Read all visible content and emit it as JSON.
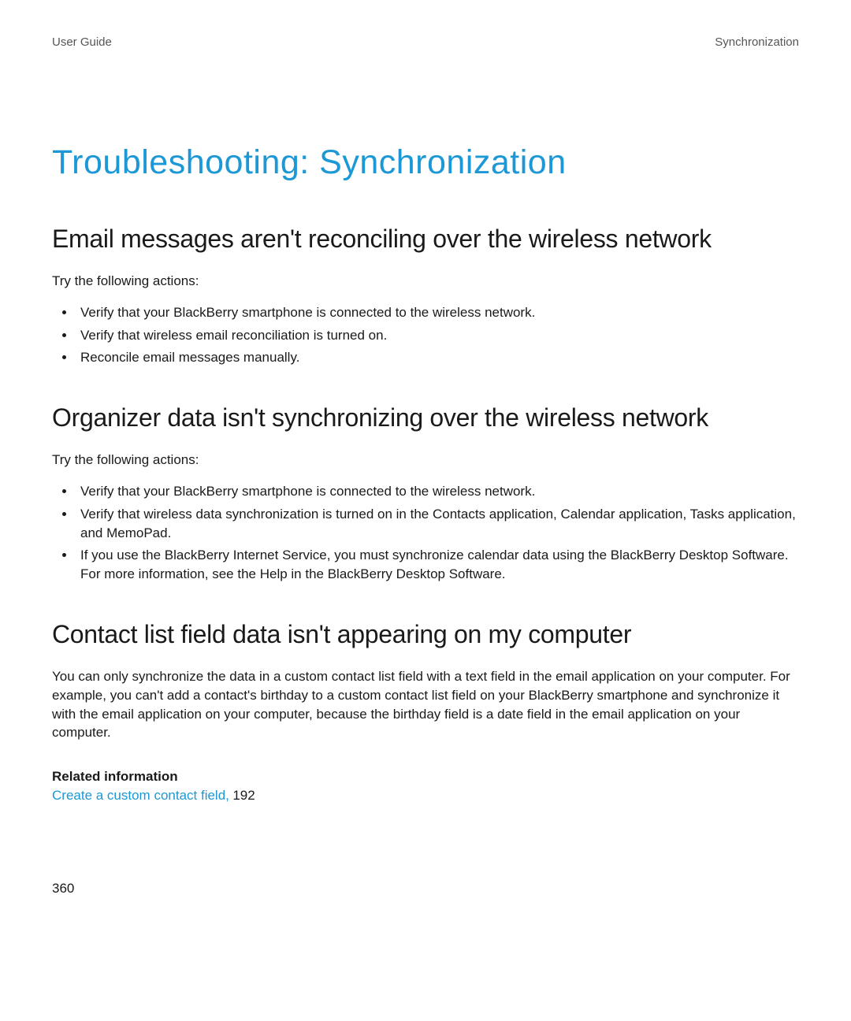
{
  "header": {
    "left": "User Guide",
    "right": "Synchronization"
  },
  "title": "Troubleshooting: Synchronization",
  "sections": [
    {
      "heading": "Email messages aren't reconciling over the wireless network",
      "intro": "Try the following actions:",
      "bullets": [
        "Verify that your BlackBerry smartphone is connected to the wireless network.",
        "Verify that wireless email reconciliation is turned on.",
        "Reconcile email messages manually."
      ]
    },
    {
      "heading": "Organizer data isn't synchronizing over the wireless network",
      "intro": "Try the following actions:",
      "bullets": [
        "Verify that your BlackBerry smartphone is connected to the wireless network.",
        "Verify that wireless data synchronization is turned on in the Contacts application, Calendar application, Tasks application, and MemoPad.",
        "If you use the BlackBerry Internet Service, you must synchronize calendar data using the BlackBerry Desktop Software. For more information, see the Help in the BlackBerry Desktop Software."
      ]
    },
    {
      "heading": "Contact list field data isn't appearing on my computer",
      "paragraph": "You can only synchronize the data in a custom contact list field with a text field in the email application on your computer. For example, you can't add a contact's birthday to a custom contact list field on your BlackBerry smartphone and synchronize it with the email application on your computer, because the birthday field is a date field in the email application on your computer."
    }
  ],
  "related": {
    "heading": "Related information",
    "link_text": "Create a custom contact field,",
    "page": "192"
  },
  "page_number": "360"
}
